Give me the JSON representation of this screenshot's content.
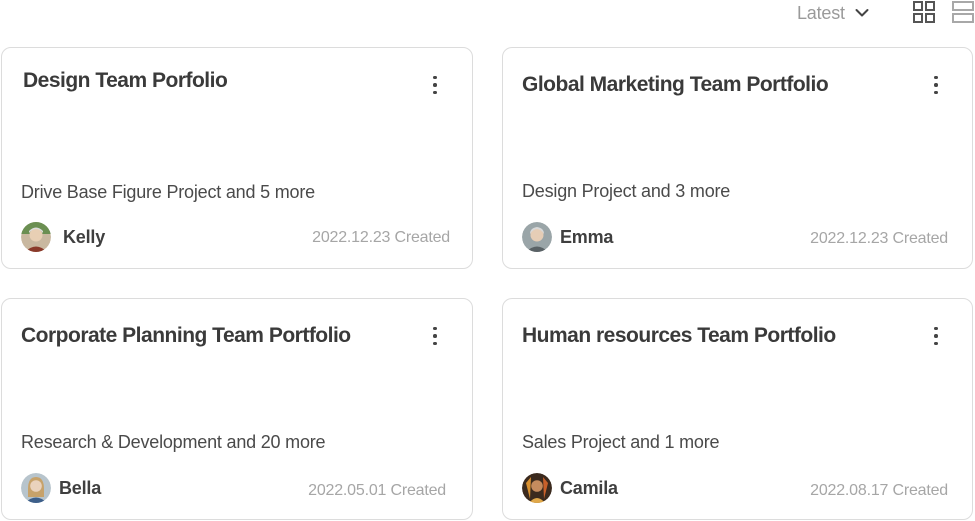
{
  "toolbar": {
    "sort_label": "Latest",
    "sort_icon": "chevron-down-icon",
    "grid_view_icon": "grid-view-icon",
    "list_view_icon": "list-view-icon"
  },
  "cards": [
    {
      "title": "Design Team Porfolio",
      "projects": "Drive Base Figure Project and 5 more",
      "owner": "Kelly",
      "date": "2022.12.23 Created"
    },
    {
      "title": "Global Marketing Team Portfolio",
      "projects": "Design Project and 3 more",
      "owner": "Emma",
      "date": "2022.12.23 Created"
    },
    {
      "title": "Corporate Planning Team Portfolio",
      "projects": "Research & Development and 20 more",
      "owner": "Bella",
      "date": "2022.05.01 Created"
    },
    {
      "title": "Human resources Team Portfolio",
      "projects": "Sales Project and 1 more",
      "owner": "Camila",
      "date": "2022.08.17 Created"
    }
  ],
  "colors": {
    "card_border": "#dcdcdc",
    "title_text": "#3a3a3a",
    "muted_text": "#a6a6a6",
    "icon": "#555555"
  }
}
